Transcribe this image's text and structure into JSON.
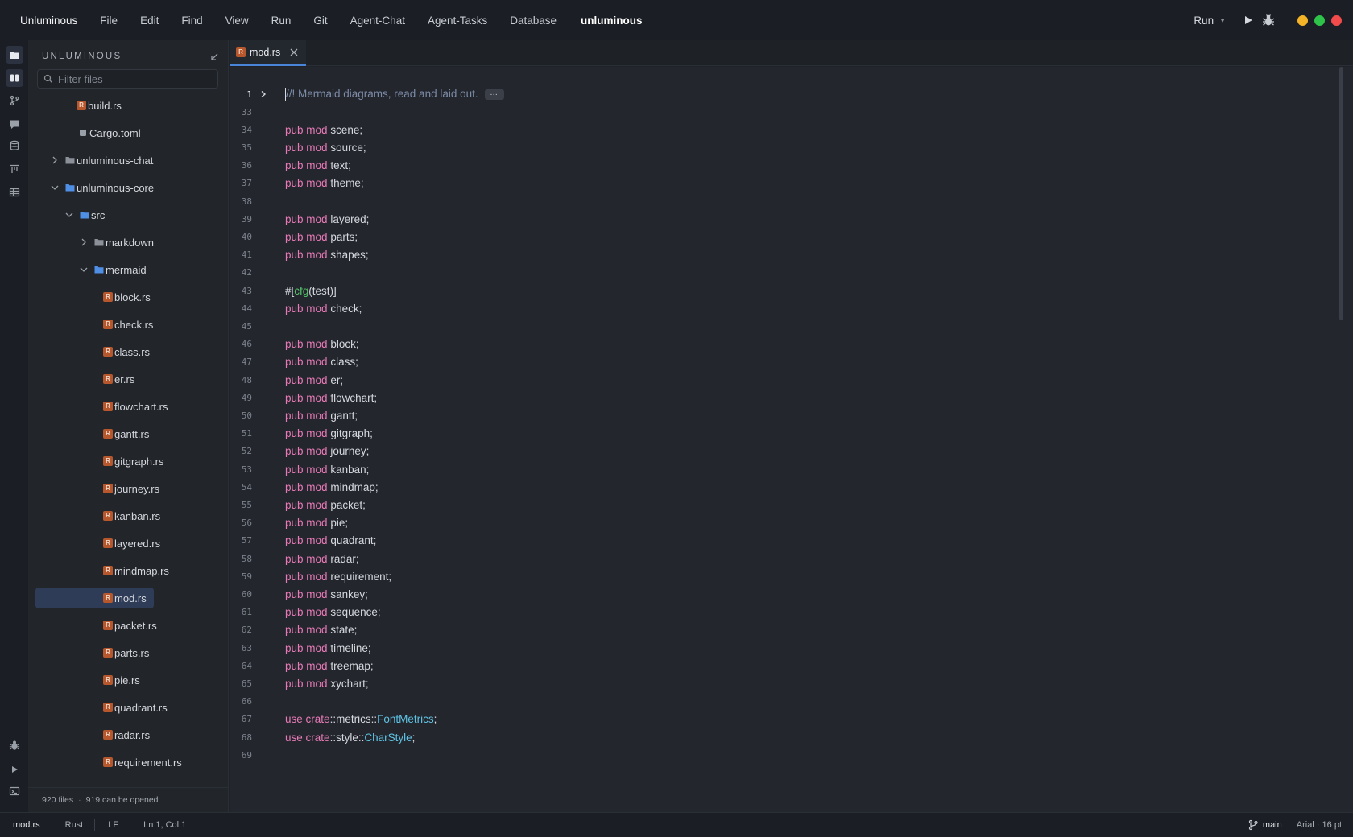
{
  "menubar": {
    "app_name": "Unluminous",
    "menus": [
      "File",
      "Edit",
      "Find",
      "View",
      "Run",
      "Git",
      "Agent-Chat",
      "Agent-Tasks",
      "Database"
    ],
    "workspace": "unluminous",
    "run_label": "Run"
  },
  "activity_icons": [
    "files-icon",
    "explorer-icon",
    "git-branch-icon",
    "chat-icon",
    "database-icon",
    "tasks-icon",
    "table-icon",
    "debug-icon",
    "run-icon",
    "terminal-icon"
  ],
  "sidebar": {
    "title": "UNLUMINOUS",
    "filter_placeholder": "Filter files",
    "items": [
      {
        "label": "build.rs",
        "kind": "rs",
        "depth": 3
      },
      {
        "label": "Cargo.toml",
        "kind": "toml",
        "depth": 3
      },
      {
        "label": "unluminous-chat",
        "kind": "folder-closed",
        "depth": 1
      },
      {
        "label": "unluminous-core",
        "kind": "folder-open",
        "depth": 1
      },
      {
        "label": "src",
        "kind": "folder-open",
        "depth": 2
      },
      {
        "label": "markdown",
        "kind": "folder-closed",
        "depth": 3
      },
      {
        "label": "mermaid",
        "kind": "folder-open",
        "depth": 3
      },
      {
        "label": "block.rs",
        "kind": "rs",
        "depth": 5
      },
      {
        "label": "check.rs",
        "kind": "rs",
        "depth": 5
      },
      {
        "label": "class.rs",
        "kind": "rs",
        "depth": 5
      },
      {
        "label": "er.rs",
        "kind": "rs",
        "depth": 5
      },
      {
        "label": "flowchart.rs",
        "kind": "rs",
        "depth": 5
      },
      {
        "label": "gantt.rs",
        "kind": "rs",
        "depth": 5
      },
      {
        "label": "gitgraph.rs",
        "kind": "rs",
        "depth": 5
      },
      {
        "label": "journey.rs",
        "kind": "rs",
        "depth": 5
      },
      {
        "label": "kanban.rs",
        "kind": "rs",
        "depth": 5
      },
      {
        "label": "layered.rs",
        "kind": "rs",
        "depth": 5
      },
      {
        "label": "mindmap.rs",
        "kind": "rs",
        "depth": 5
      },
      {
        "label": "mod.rs",
        "kind": "rs",
        "depth": 5,
        "selected": true
      },
      {
        "label": "packet.rs",
        "kind": "rs",
        "depth": 5
      },
      {
        "label": "parts.rs",
        "kind": "rs",
        "depth": 5
      },
      {
        "label": "pie.rs",
        "kind": "rs",
        "depth": 5
      },
      {
        "label": "quadrant.rs",
        "kind": "rs",
        "depth": 5
      },
      {
        "label": "radar.rs",
        "kind": "rs",
        "depth": 5
      },
      {
        "label": "requirement.rs",
        "kind": "rs",
        "depth": 5
      }
    ],
    "footer": {
      "files": "920 files",
      "openable": "919 can be opened"
    }
  },
  "tabs": [
    {
      "label": "mod.rs",
      "active": true
    }
  ],
  "editor": {
    "lines": [
      {
        "n": "1",
        "type": "comment",
        "text": "//! Mermaid diagrams, read and laid out.",
        "folded": true
      },
      {
        "n": "33",
        "type": "blank"
      },
      {
        "n": "34",
        "type": "mod",
        "name": "scene"
      },
      {
        "n": "35",
        "type": "mod",
        "name": "source"
      },
      {
        "n": "36",
        "type": "mod",
        "name": "text"
      },
      {
        "n": "37",
        "type": "mod",
        "name": "theme"
      },
      {
        "n": "38",
        "type": "blank"
      },
      {
        "n": "39",
        "type": "mod",
        "name": "layered"
      },
      {
        "n": "40",
        "type": "mod",
        "name": "parts"
      },
      {
        "n": "41",
        "type": "mod",
        "name": "shapes"
      },
      {
        "n": "42",
        "type": "blank"
      },
      {
        "n": "43",
        "type": "attr",
        "pre": "#[",
        "fn": "cfg",
        "post": "(test)]"
      },
      {
        "n": "44",
        "type": "mod",
        "name": "check"
      },
      {
        "n": "45",
        "type": "blank"
      },
      {
        "n": "46",
        "type": "mod",
        "name": "block"
      },
      {
        "n": "47",
        "type": "mod",
        "name": "class"
      },
      {
        "n": "48",
        "type": "mod",
        "name": "er"
      },
      {
        "n": "49",
        "type": "mod",
        "name": "flowchart"
      },
      {
        "n": "50",
        "type": "mod",
        "name": "gantt"
      },
      {
        "n": "51",
        "type": "mod",
        "name": "gitgraph"
      },
      {
        "n": "52",
        "type": "mod",
        "name": "journey"
      },
      {
        "n": "53",
        "type": "mod",
        "name": "kanban"
      },
      {
        "n": "54",
        "type": "mod",
        "name": "mindmap"
      },
      {
        "n": "55",
        "type": "mod",
        "name": "packet"
      },
      {
        "n": "56",
        "type": "mod",
        "name": "pie"
      },
      {
        "n": "57",
        "type": "mod",
        "name": "quadrant"
      },
      {
        "n": "58",
        "type": "mod",
        "name": "radar"
      },
      {
        "n": "59",
        "type": "mod",
        "name": "requirement"
      },
      {
        "n": "60",
        "type": "mod",
        "name": "sankey"
      },
      {
        "n": "61",
        "type": "mod",
        "name": "sequence"
      },
      {
        "n": "62",
        "type": "mod",
        "name": "state"
      },
      {
        "n": "63",
        "type": "mod",
        "name": "timeline"
      },
      {
        "n": "64",
        "type": "mod",
        "name": "treemap"
      },
      {
        "n": "65",
        "type": "mod",
        "name": "xychart"
      },
      {
        "n": "66",
        "type": "blank"
      },
      {
        "n": "67",
        "type": "use",
        "path": "metrics",
        "ty": "FontMetrics"
      },
      {
        "n": "68",
        "type": "use",
        "path": "style",
        "ty": "CharStyle"
      },
      {
        "n": "69",
        "type": "blank"
      }
    ],
    "keywords": {
      "pub": "pub",
      "mod": "mod",
      "use": "use",
      "crate": "crate"
    }
  },
  "statusbar": {
    "file": "mod.rs",
    "language": "Rust",
    "eol": "LF",
    "position": "Ln 1, Col 1",
    "branch": "main",
    "font": "Arial · 16 pt"
  },
  "colors": {
    "keyword": "#e87ab8",
    "type": "#5fc3e4",
    "function": "#55c26b",
    "comment": "#7c8ba8",
    "accent": "#4a84d8",
    "rust_badge": "#b6572d"
  }
}
